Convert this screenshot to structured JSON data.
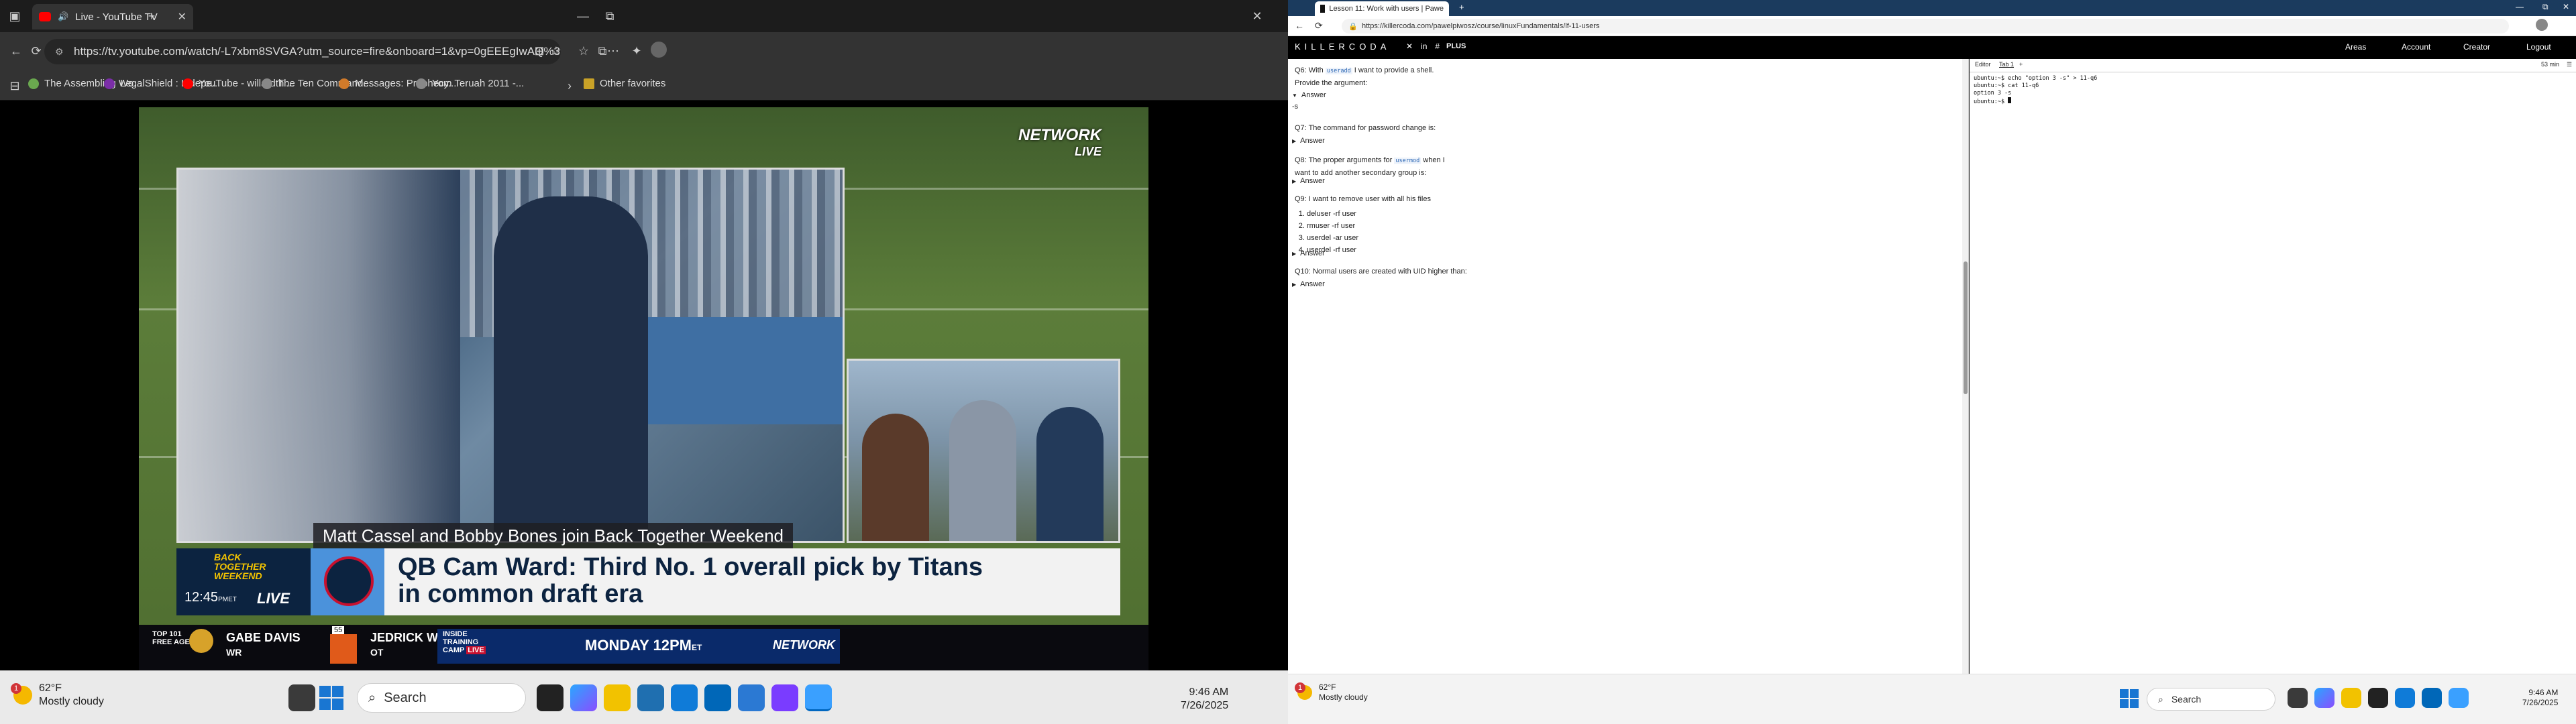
{
  "left": {
    "tab": {
      "title": "Live - YouTube TV"
    },
    "window": {
      "minimize": "—",
      "restore": "⧉",
      "close": "✕"
    },
    "address": {
      "url": "https://tv.youtube.com/watch/-L7xbm8SVGA?utm_source=fire&onboard=1&vp=0gEEEgIwAQ%3D%3D"
    },
    "favorites": [
      {
        "label": "The Assembling Wo...",
        "color": "#6aa84f"
      },
      {
        "label": "LegalShield : Indepe...",
        "color": "#7b2ea8"
      },
      {
        "label": "YouTube - willardth'...",
        "color": "#ff0000"
      },
      {
        "label": "The Ten Command...",
        "color": "#888888"
      },
      {
        "label": "Messages: Prophecy...",
        "color": "#d07a2a"
      },
      {
        "label": "Yom Teruah 2011 -...",
        "color": "#888888"
      }
    ],
    "other_favorites": "Other favorites",
    "video": {
      "network_bug": [
        "NETWORK",
        "LIVE"
      ],
      "name_strap": "Matt Cassel and Bobby Bones join Back Together Weekend",
      "event": [
        "BACK",
        "TOGETHER",
        "WEEKEND"
      ],
      "clock": "12:45",
      "clock_ampm": "PM",
      "clock_tz": "ET",
      "live": "LIVE",
      "headline": [
        "QB Cam Ward: Third No. 1 overall pick by Titans",
        "in common draft era"
      ],
      "ticker_label": [
        "TOP 101",
        "FREE AGENTS"
      ],
      "ticker_rank": "55",
      "player1": {
        "name": "GABE DAVIS",
        "pos": "WR"
      },
      "player2": {
        "name": "JEDRICK WILLS",
        "pos": "OT"
      },
      "promo": [
        "INSIDE",
        "TRAINING",
        "CAMP"
      ],
      "promo_live": "LIVE",
      "promo_time": "MONDAY 12PM",
      "promo_tz": "ET",
      "promo_network": "NETWORK"
    },
    "taskbar": {
      "temp": "62°F",
      "condition": "Mostly cloudy",
      "alert_count": "1",
      "search": "Search",
      "time": "9:46 AM",
      "date": "7/26/2025"
    }
  },
  "right": {
    "tab": {
      "title": "Lesson 11: Work with users | Pawe"
    },
    "address": {
      "url": "https://killercoda.com/pawelpiwosz/course/linuxFundamentals/lf-11-users"
    },
    "nav": {
      "logo": "KILLERCODA",
      "plus": "PLUS",
      "links": [
        "Areas",
        "Account",
        "Creator",
        "Logout"
      ]
    },
    "questions": {
      "q6_pre": "Q6: With",
      "q6_code": "useradd",
      "q6_post": "I want to provide a shell. Provide the",
      "q6_post2": "argument:",
      "q6_answer_label": "Answer",
      "q6_answer": "-s",
      "q7": "Q7: The command for password change is:",
      "q7_answer_label": "Answer",
      "q8_pre": "Q8: The proper arguments for",
      "q8_code": "usermod",
      "q8_post": "when I want to",
      "q8_post2": "add another secondary group is:",
      "q8_answer_label": "Answer",
      "q9": "Q9: I want to remove user with all his files",
      "q9_options": [
        "deluser -rf user",
        "rmuser -rf user",
        "userdel -ar user",
        "userdel -rf user"
      ],
      "q9_answer_label": "Answer",
      "q10": "Q10: Normal users are created with UID higher than:",
      "q10_answer_label": "Answer"
    },
    "terminal": {
      "tabs": [
        "Editor",
        "Tab 1",
        "+"
      ],
      "timer": "53 min",
      "lines": [
        "ubuntu:~$ echo \"option 3 -s\" > 11-q6",
        "ubuntu:~$ cat 11-q6",
        "option 3 -s",
        "ubuntu:~$ "
      ]
    },
    "taskbar": {
      "temp": "62°F",
      "condition": "Mostly cloudy",
      "alert_count": "1",
      "search": "Search",
      "time": "9:46 AM",
      "date": "7/26/2025"
    }
  }
}
